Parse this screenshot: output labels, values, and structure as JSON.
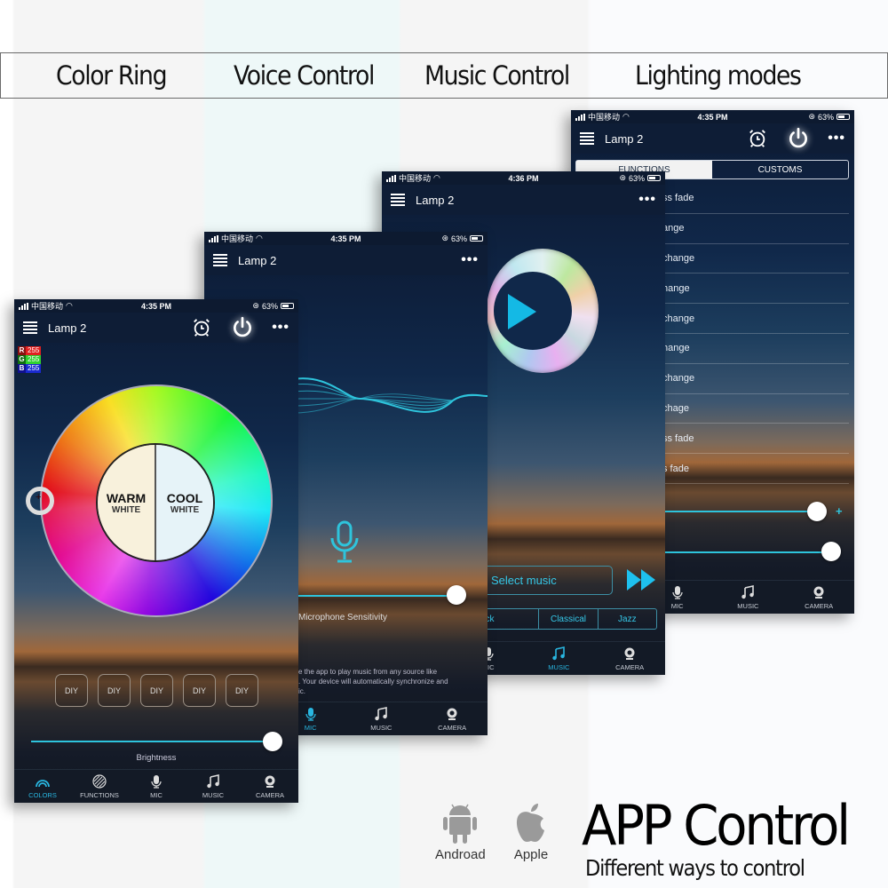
{
  "banner": {
    "features": [
      "Color Ring",
      "Voice Control",
      "Music Control",
      "Lighting modes"
    ]
  },
  "status": {
    "carrier": "中国移动",
    "battery": "63%"
  },
  "phones": {
    "color_ring": {
      "time": "4:35 PM",
      "title": "Lamp 2",
      "rgb": {
        "r_label": "R",
        "r": "255",
        "g_label": "G",
        "g": "255",
        "b_label": "B",
        "b": "255"
      },
      "warm": {
        "line1": "WARM",
        "line2": "WHITE"
      },
      "cool": {
        "line1": "COOL",
        "line2": "WHITE"
      },
      "diy_buttons": [
        "DIY",
        "DIY",
        "DIY",
        "DIY",
        "DIY"
      ],
      "brightness_label": "Brightness",
      "brightness_level": 1.0,
      "active_tab": "COLORS"
    },
    "voice": {
      "time": "4:35 PM",
      "title": "Lamp 2",
      "sensitivity_label": "Microphone Sensitivity",
      "sensitivity_level": 1.0,
      "description_lines": [
        "e the app to play music from any source like",
        ". Your device will automatically synchronize and",
        "ic."
      ],
      "active_tab": "MIC"
    },
    "music": {
      "time": "4:36 PM",
      "title": "Lamp 2",
      "select_music": "Select music",
      "genres": [
        "ock",
        "Classical",
        "Jazz"
      ],
      "active_tab": "MUSIC"
    },
    "lighting": {
      "time": "4:35 PM",
      "title": "Lamp 2",
      "segments": [
        "FUNCTIONS",
        "CUSTOMS"
      ],
      "modes": [
        "ss fade",
        "ange",
        "change",
        "hange",
        "change",
        "hange",
        "change",
        "chage",
        "ss fade",
        "s fade"
      ],
      "speed_level": 0.88,
      "brightness_level": 1.0,
      "active_tab": "FUNCTIONS"
    }
  },
  "tabs": [
    "COLORS",
    "FUNCTIONS",
    "MIC",
    "MUSIC",
    "CAMERA"
  ],
  "tabs_partial": {
    "functions_cut": "NS"
  },
  "accent_color": "#29b6e0",
  "footer": {
    "android_label": "Androad",
    "apple_label": "Apple",
    "title": "APP Control",
    "subtitle": "Different ways to control"
  }
}
